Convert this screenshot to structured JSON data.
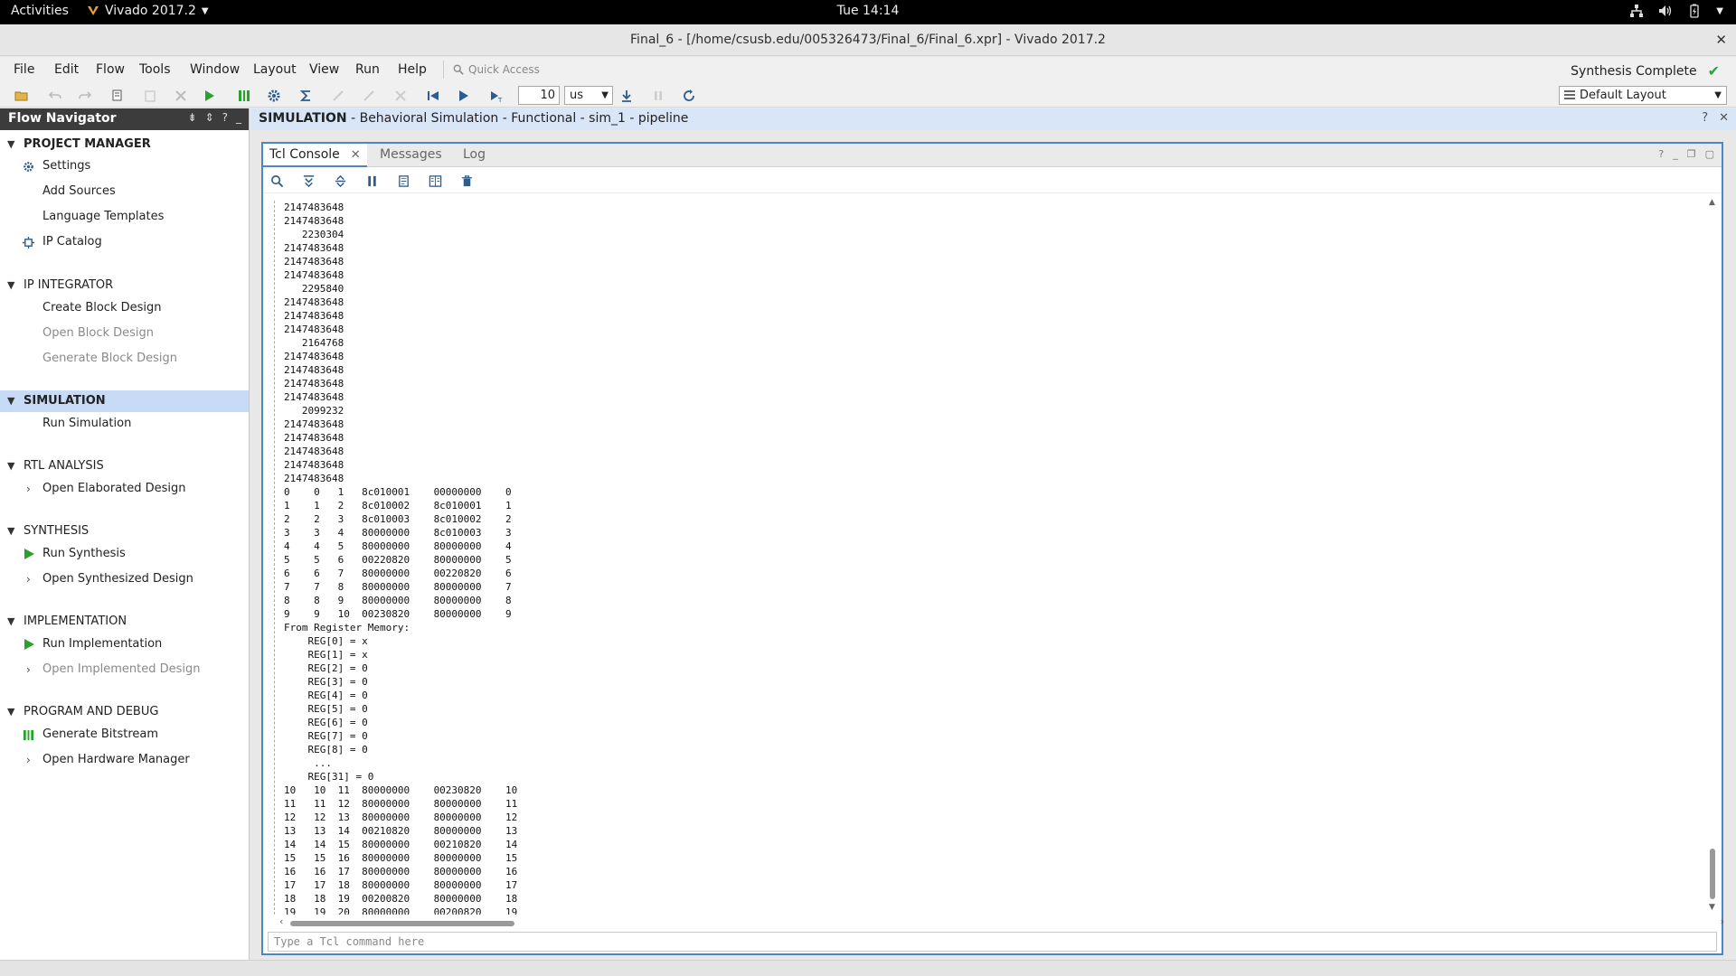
{
  "topbar": {
    "activities": "Activities",
    "app_name": "Vivado 2017.2",
    "clock": "Tue 14:14"
  },
  "window": {
    "title": "Final_6 - [/home/csusb.edu/005326473/Final_6/Final_6.xpr] - Vivado 2017.2"
  },
  "menu": {
    "items": [
      "File",
      "Edit",
      "Flow",
      "Tools",
      "Window",
      "Layout",
      "View",
      "Run",
      "Help"
    ],
    "quick_access_placeholder": "Quick Access",
    "status": "Synthesis Complete"
  },
  "toolbar": {
    "time_value": "10",
    "time_unit": "us",
    "layout": "Default Layout"
  },
  "flow_navigator": {
    "title": "Flow Navigator",
    "sections": [
      {
        "label": "PROJECT MANAGER",
        "items": [
          "Settings",
          "Add Sources",
          "Language Templates",
          "IP Catalog"
        ]
      },
      {
        "label": "IP INTEGRATOR",
        "items": [
          "Create Block Design",
          "Open Block Design",
          "Generate Block Design"
        ]
      },
      {
        "label": "SIMULATION",
        "items": [
          "Run Simulation"
        ]
      },
      {
        "label": "RTL ANALYSIS",
        "items": [
          "Open Elaborated Design"
        ]
      },
      {
        "label": "SYNTHESIS",
        "items": [
          "Run Synthesis",
          "Open Synthesized Design"
        ]
      },
      {
        "label": "IMPLEMENTATION",
        "items": [
          "Run Implementation",
          "Open Implemented Design"
        ]
      },
      {
        "label": "PROGRAM AND DEBUG",
        "items": [
          "Generate Bitstream",
          "Open Hardware Manager"
        ]
      }
    ]
  },
  "simulation": {
    "header_bold": "SIMULATION",
    "header_rest": " - Behavioral Simulation - Functional - sim_1 - pipeline"
  },
  "console": {
    "tabs": [
      "Tcl Console",
      "Messages",
      "Log"
    ],
    "input_placeholder": "Type a Tcl command here",
    "lines": [
      "2147483648",
      "2147483648",
      "   2230304",
      "2147483648",
      "2147483648",
      "2147483648",
      "   2295840",
      "2147483648",
      "2147483648",
      "2147483648",
      "   2164768",
      "2147483648",
      "2147483648",
      "2147483648",
      "2147483648",
      "   2099232",
      "2147483648",
      "2147483648",
      "2147483648",
      "2147483648",
      "2147483648",
      "0    0   1   8c010001    00000000    0",
      "1    1   2   8c010002    8c010001    1",
      "2    2   3   8c010003    8c010002    2",
      "3    3   4   80000000    8c010003    3",
      "4    4   5   80000000    80000000    4",
      "5    5   6   00220820    80000000    5",
      "6    6   7   80000000    00220820    6",
      "7    7   8   80000000    80000000    7",
      "8    8   9   80000000    80000000    8",
      "9    9   10  00230820    80000000    9",
      "From Register Memory:",
      "    REG[0] = x",
      "    REG[1] = x",
      "    REG[2] = 0",
      "    REG[3] = 0",
      "    REG[4] = 0",
      "    REG[5] = 0",
      "    REG[6] = 0",
      "    REG[7] = 0",
      "    REG[8] = 0",
      "     ...",
      "    REG[31] = 0",
      "10   10  11  80000000    00230820    10",
      "11   11  12  80000000    80000000    11",
      "12   12  13  80000000    80000000    12",
      "13   13  14  00210820    80000000    13",
      "14   14  15  80000000    00210820    14",
      "15   15  16  80000000    80000000    15",
      "16   16  17  80000000    80000000    16",
      "17   17  18  80000000    80000000    17",
      "18   18  19  00200820    80000000    18",
      "19   19  20  80000000    00200820    19"
    ]
  },
  "colors": {
    "accent": "#4a86c8",
    "selected_row": "#c7dbf6",
    "run_green": "#2ca02c",
    "header_dark": "#3c3c3c"
  }
}
